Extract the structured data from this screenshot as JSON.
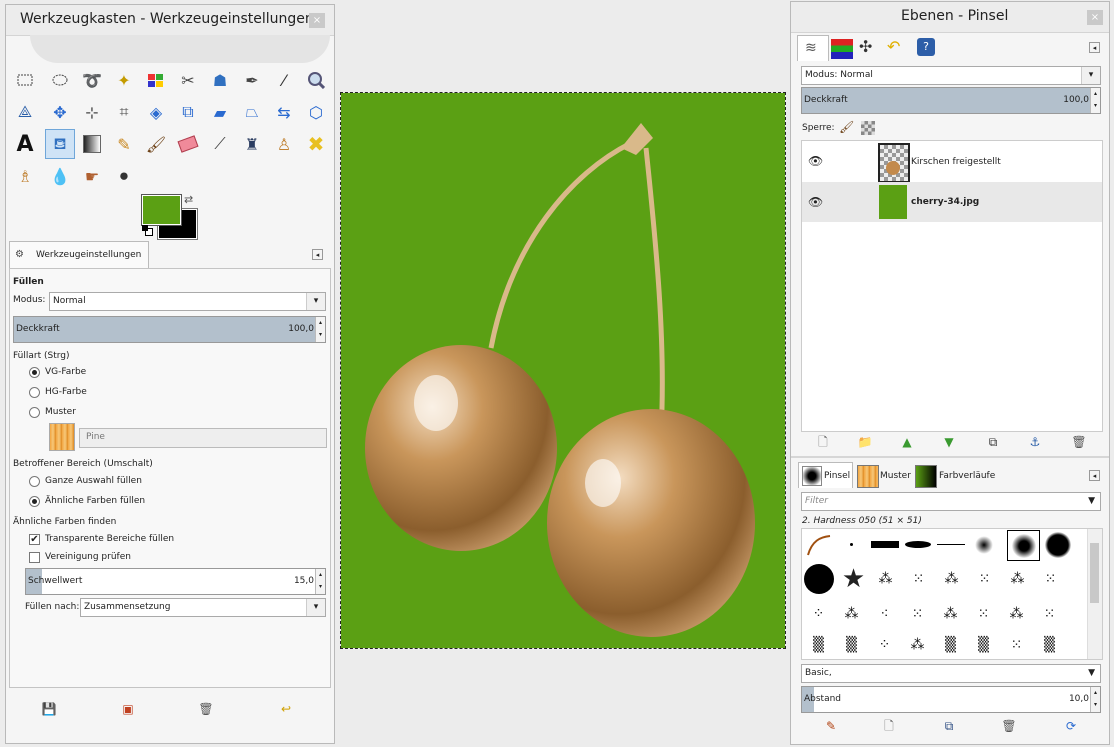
{
  "toolbox": {
    "title": "Werkzeugkasten - Werkzeugeinstellungen",
    "close": "×",
    "fg_color": "#5ba014",
    "bg_color": "#000000",
    "tab_label": "Werkzeugeinstellungen",
    "section_title": "Füllen",
    "mode_label": "Modus:",
    "mode_value": "Normal",
    "opacity_label": "Deckkraft",
    "opacity_value": "100,0",
    "fill_type_label": "Füllart  (Strg)",
    "fill_options": [
      "VG-Farbe",
      "HG-Farbe",
      "Muster"
    ],
    "fill_selected": "VG-Farbe",
    "pattern_name": "Pine",
    "affected_label": "Betroffener Bereich (Umschalt)",
    "affected_options": [
      "Ganze Auswahl füllen",
      "Ähnliche Farben füllen"
    ],
    "affected_selected": "Ähnliche Farben füllen",
    "similar_label": "Ähnliche Farben finden",
    "transparent_label": "Transparente Bereiche füllen",
    "transparent_checked": true,
    "merge_label": "Vereinigung prüfen",
    "merge_checked": false,
    "threshold_label": "Schwellwert",
    "threshold_value": "15,0",
    "fill_by_label": "Füllen nach:",
    "fill_by_value": "Zusammensetzung",
    "tools": [
      "rect-select",
      "ellipse-select",
      "free-select",
      "fuzzy-select",
      "color-select",
      "scissors",
      "foreground-select",
      "paths",
      "color-picker",
      "zoom",
      "measure",
      "move",
      "align",
      "crop",
      "rotate",
      "scale",
      "shear",
      "perspective",
      "flip",
      "cage-transform",
      "text",
      "bucket-fill",
      "blend",
      "pencil",
      "paintbrush",
      "eraser",
      "airbrush",
      "ink",
      "clone",
      "heal",
      "perspective-clone",
      "blur",
      "smudge",
      "dodge-burn"
    ]
  },
  "layers": {
    "title": "Ebenen - Pinsel",
    "close": "×",
    "mode_label": "Modus: Normal",
    "opacity_label": "Deckkraft",
    "opacity_value": "100,0",
    "lock_label": "Sperre:",
    "items": [
      {
        "name": "Kirschen freigestellt",
        "visible": true
      },
      {
        "name": "cherry-34.jpg",
        "visible": true,
        "active": true
      }
    ],
    "layer_color": "#5ba014"
  },
  "brushes": {
    "tabs": [
      "Pinsel",
      "Muster",
      "Farbverläufe"
    ],
    "filter_placeholder": "Filter",
    "selected_brush": "2. Hardness 050 (51 × 51)",
    "tag_value": "Basic,",
    "spacing_label": "Abstand",
    "spacing_value": "10,0"
  },
  "canvas": {
    "background": "#5ba014",
    "cherry_color": "#b7854c"
  }
}
